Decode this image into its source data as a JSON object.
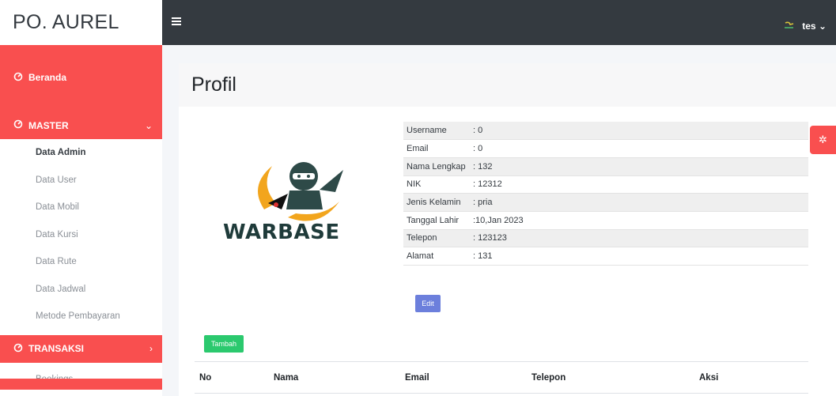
{
  "app": {
    "brand": "PO. AUREL"
  },
  "topbar": {
    "user_name": "tes",
    "user_caret": "⌄"
  },
  "sidebar": {
    "beranda_label": "Beranda",
    "master_label": "MASTER",
    "master_chevron": "⌄",
    "master_items": [
      {
        "label": "Data Admin",
        "active": true
      },
      {
        "label": "Data User"
      },
      {
        "label": "Data Mobil"
      },
      {
        "label": "Data Kursi"
      },
      {
        "label": "Data Rute"
      },
      {
        "label": "Data Jadwal"
      },
      {
        "label": "Metode Pembayaran"
      }
    ],
    "transaksi_label": "TRANSAKSI",
    "transaksi_chevron": "›",
    "transaksi_items": [
      {
        "label": "Bookings"
      }
    ]
  },
  "page": {
    "title": "Profil"
  },
  "logo": {
    "text": "WARBASE"
  },
  "profile": {
    "rows": [
      {
        "key": "Username",
        "value": ": 0"
      },
      {
        "key": "Email",
        "value": ": 0"
      },
      {
        "key": "Nama Lengkap",
        "value": ": 132"
      },
      {
        "key": "NIK",
        "value": ": 12312"
      },
      {
        "key": "Jenis Kelamin",
        "value": ": pria"
      },
      {
        "key": "Tanggal Lahir",
        "value": ":10,Jan 2023"
      },
      {
        "key": "Telepon",
        "value": ": 123123"
      },
      {
        "key": "Alamat",
        "value": ": 131"
      }
    ],
    "edit_label": "Edit"
  },
  "table": {
    "add_label": "Tambah",
    "columns": [
      "No",
      "Nama",
      "Email",
      "Telepon",
      "Aksi"
    ]
  },
  "colors": {
    "accent_red": "#f94f4f",
    "topbar": "#343a40",
    "edit_button": "#6c7fdc",
    "add_button": "#2bc96e"
  }
}
